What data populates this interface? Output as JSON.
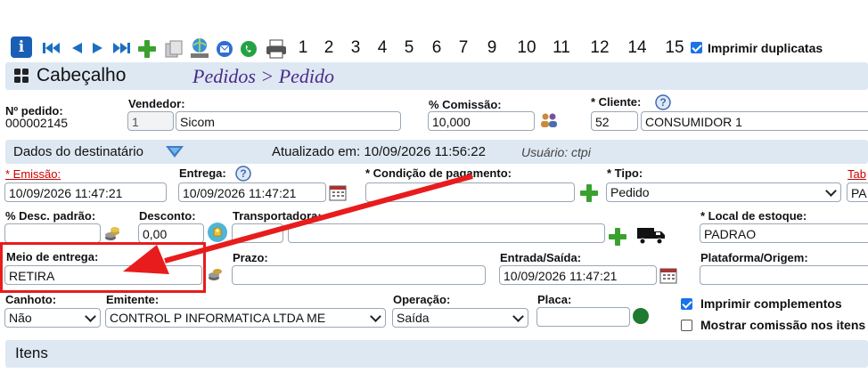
{
  "toolbar": {
    "numbers": [
      "1",
      "2",
      "3",
      "4",
      "5",
      "6",
      "7",
      "9",
      "10",
      "11",
      "12",
      "14",
      "15"
    ],
    "print_duplicates_label": "Imprimir duplicatas",
    "print_duplicates_checked": true
  },
  "header": {
    "section_title": "Cabeçalho",
    "breadcrumb": "Pedidos > Pedido"
  },
  "order": {
    "number_label": "Nº pedido:",
    "number_value": "000002145",
    "seller_label": "Vendedor:",
    "seller_code": "1",
    "seller_name": "Sicom",
    "commission_label": "% Comissão:",
    "commission_value": "10,000",
    "client_label": "* Cliente:",
    "client_code": "52",
    "client_name": "CONSUMIDOR 1"
  },
  "recipient_bar": {
    "title": "Dados do destinatário",
    "updated": "Atualizado em: 10/09/2026 11:56:22",
    "user": "Usuário: ctpi"
  },
  "row2": {
    "emission_label": "* Emissão:",
    "emission_value": "10/09/2026 11:47:21",
    "delivery_label": "Entrega:",
    "delivery_value": "10/09/2026 11:47:21",
    "payment_label": "* Condição de pagamento:",
    "payment_value": "",
    "type_label": "* Tipo:",
    "type_value": "Pedido",
    "table_label": "Tab",
    "table_value": "PA"
  },
  "row3": {
    "discount_pct_label": "% Desc. padrão:",
    "discount_pct_value": "",
    "discount_label": "Desconto:",
    "discount_value": "0,00",
    "carrier_label": "Transportadora:",
    "stock_label": "* Local de estoque:",
    "stock_value": "PADRAO"
  },
  "row4": {
    "delivery_method_label": "Meio de entrega:",
    "delivery_method_value": "RETIRA",
    "term_label": "Prazo:",
    "term_value": "",
    "entry_exit_label": "Entrada/Saída:",
    "entry_exit_value": "10/09/2026 11:47:21",
    "platform_label": "Plataforma/Origem:",
    "platform_value": ""
  },
  "row5": {
    "stub_label": "Canhoto:",
    "stub_value": "Não",
    "issuer_label": "Emitente:",
    "issuer_value": "CONTROL P INFORMATICA LTDA ME",
    "operation_label": "Operação:",
    "operation_value": "Saída",
    "plate_label": "Placa:",
    "plate_value": "",
    "print_complements_label": "Imprimir complementos",
    "print_complements_checked": true,
    "show_commission_label": "Mostrar comissão nos itens",
    "show_commission_checked": false
  },
  "items_bar": {
    "title": "Itens"
  },
  "colors": {
    "accent": "#1a73e8",
    "annotation_red": "#e81c1c",
    "breadcrumb": "#4b2a8a",
    "bar_bg": "#dde8f2"
  },
  "icons": [
    "info-icon",
    "first-icon",
    "prev-icon",
    "next-icon",
    "last-icon",
    "add-icon",
    "copy-icon",
    "globe-icon",
    "email-icon",
    "whatsapp-icon",
    "printer-icon",
    "people-icon",
    "calendar-icon",
    "truck-icon",
    "coins-icon",
    "tag-icon",
    "status-dot-icon",
    "chevron-down-icon"
  ]
}
